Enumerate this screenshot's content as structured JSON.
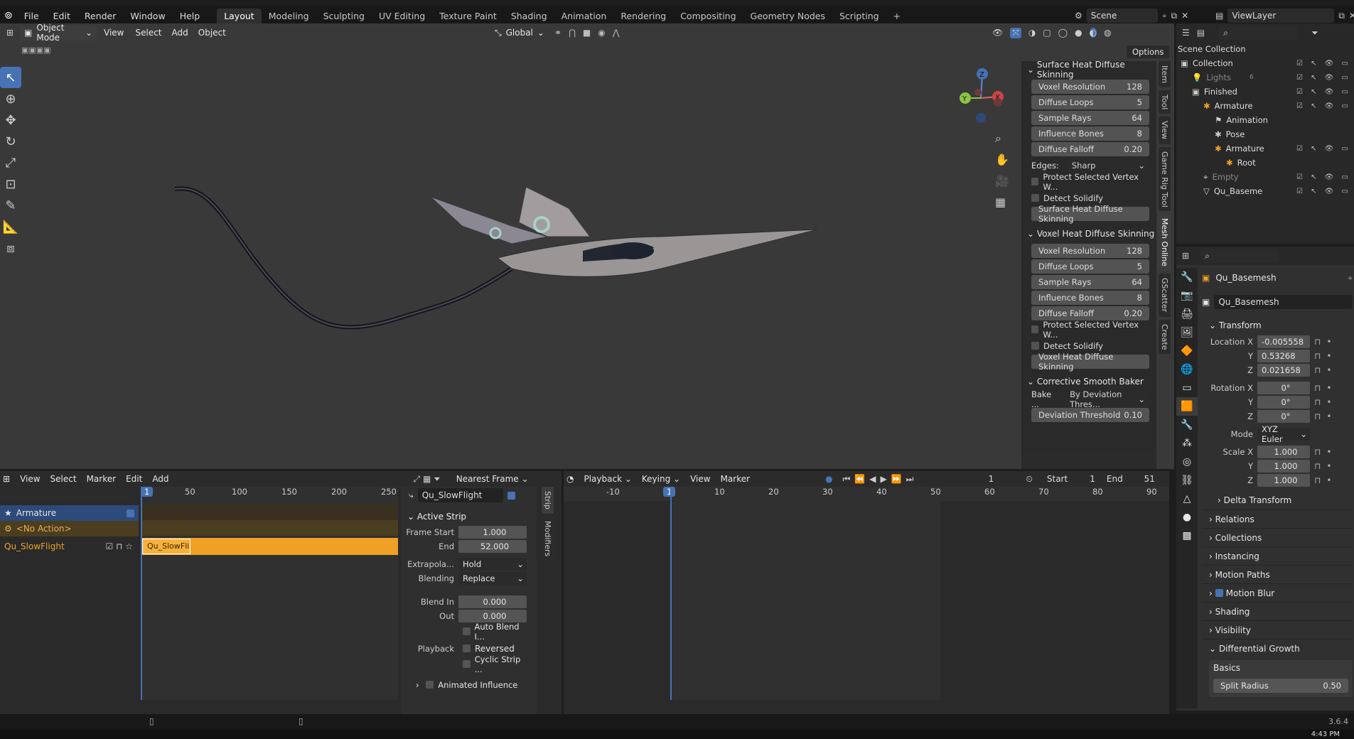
{
  "menu": {
    "file": "File",
    "edit": "Edit",
    "render": "Render",
    "window": "Window",
    "help": "Help"
  },
  "workspaces": [
    "Layout",
    "Modeling",
    "Sculpting",
    "UV Editing",
    "Texture Paint",
    "Shading",
    "Animation",
    "Rendering",
    "Compositing",
    "Geometry Nodes",
    "Scripting"
  ],
  "add_tab": "+",
  "scene": {
    "name": "Scene",
    "view_layer": "ViewLayer"
  },
  "viewport": {
    "mode": "Object Mode",
    "view": "View",
    "select": "Select",
    "add": "Add",
    "object": "Object",
    "orientation": "Global",
    "options": "Options",
    "gizmo": {
      "x": "X",
      "y": "Y",
      "z": "Z"
    }
  },
  "npanel": {
    "tabs": [
      "Item",
      "Tool",
      "View",
      "Game Rig Tool",
      "Mesh Online",
      "GScatter",
      "Create"
    ],
    "surface": {
      "title": "Surface Heat Diffuse Skinning",
      "fields": [
        [
          "Voxel Resolution",
          "128"
        ],
        [
          "Diffuse Loops",
          "5"
        ],
        [
          "Sample Rays",
          "64"
        ],
        [
          "Influence Bones",
          "8"
        ],
        [
          "Diffuse Falloff",
          "0.20"
        ]
      ],
      "edges_label": "Edges:",
      "edges_value": "Sharp",
      "protect": "Protect Selected Vertex W...",
      "solidify": "Detect Solidify",
      "button": "Surface Heat Diffuse Skinning"
    },
    "voxel": {
      "title": "Voxel Heat Diffuse Skinning",
      "fields": [
        [
          "Voxel Resolution",
          "128"
        ],
        [
          "Diffuse Loops",
          "5"
        ],
        [
          "Sample Rays",
          "64"
        ],
        [
          "Influence Bones",
          "8"
        ],
        [
          "Diffuse Falloff",
          "0.20"
        ]
      ],
      "protect": "Protect Selected Vertex W...",
      "solidify": "Detect Solidify",
      "button": "Voxel Heat Diffuse Skinning"
    },
    "corrective": {
      "title": "Corrective Smooth Baker",
      "bake_label": "Bake ...",
      "bake_value": "By Deviation Thres...",
      "threshold_label": "Deviation Threshold",
      "threshold_value": "0.10"
    }
  },
  "outliner": {
    "title": "Scene Collection",
    "rows": [
      {
        "label": "Collection",
        "indent": 0
      },
      {
        "label": "Lights",
        "indent": 1,
        "badge": "6"
      },
      {
        "label": "Finished",
        "indent": 1
      },
      {
        "label": "Armature",
        "indent": 2
      },
      {
        "label": "Animation",
        "indent": 3
      },
      {
        "label": "Pose",
        "indent": 3
      },
      {
        "label": "Armature",
        "indent": 3
      },
      {
        "label": "Root",
        "indent": 4
      },
      {
        "label": "Empty",
        "indent": 2
      },
      {
        "label": "Qu_Baseme",
        "indent": 2
      }
    ]
  },
  "properties": {
    "object_name": "Qu_Basemesh",
    "data_name": "Qu_Basemesh",
    "transform": "Transform",
    "location": {
      "label": "Location X",
      "x": "-0.005558",
      "y": "0.53268",
      "z": "0.021658"
    },
    "rotation": {
      "label": "Rotation X",
      "x": "0°",
      "y": "0°",
      "z": "0°"
    },
    "mode_label": "Mode",
    "mode_value": "XYZ Euler",
    "scale": {
      "label": "Scale X",
      "x": "1.000",
      "y": "1.000",
      "z": "1.000"
    },
    "axis": {
      "y": "Y",
      "z": "Z"
    },
    "sections": [
      "Delta Transform",
      "Relations",
      "Collections",
      "Instancing",
      "Motion Paths",
      "Motion Blur",
      "Shading",
      "Visibility",
      "Differential Growth"
    ],
    "basics": "Basics",
    "split_radius_label": "Split Radius",
    "split_radius_value": "0.50"
  },
  "nla": {
    "menus": [
      "View",
      "Select",
      "Marker",
      "Edit",
      "Add"
    ],
    "snap": "Nearest Frame",
    "frame_marker": "1",
    "ticks": [
      "50",
      "100",
      "150",
      "200",
      "250"
    ],
    "tracks": [
      {
        "label": "Armature"
      },
      {
        "label": "<No Action>"
      },
      {
        "label": "Qu_SlowFlight"
      }
    ],
    "strip": "Qu_SlowFli",
    "strip_name": "Qu_SlowFlight",
    "side_tabs": [
      "Strip",
      "Modifiers"
    ],
    "active_strip": "Active Strip",
    "frame_start_label": "Frame Start",
    "frame_start": "1.000",
    "end_label": "End",
    "end": "52.000",
    "extrapolation_label": "Extrapola...",
    "extrapolation": "Hold",
    "blending_label": "Blending",
    "blending": "Replace",
    "blend_in_label": "Blend In",
    "blend_in": "0.000",
    "out_label": "Out",
    "out": "0.000",
    "auto_blend": "Auto Blend I...",
    "playback_label": "Playback",
    "reversed": "Reversed",
    "cyclic": "Cyclic Strip ...",
    "animated_influence": "Animated Influence"
  },
  "timeline": {
    "menus": [
      "Playback",
      "Keying",
      "View",
      "Marker"
    ],
    "current_frame": "1",
    "start_label": "Start",
    "start": "1",
    "end_label": "End",
    "end": "51",
    "ticks": [
      "-10",
      "10",
      "20",
      "30",
      "40",
      "50",
      "60",
      "70",
      "80",
      "90"
    ],
    "frame_marker": "1"
  },
  "status": {
    "version": "3.6.4",
    "time": "4:43 PM"
  },
  "colors": {
    "accent": "#4772b3",
    "strip": "#f0a024",
    "track_action": "#4b3d20"
  }
}
